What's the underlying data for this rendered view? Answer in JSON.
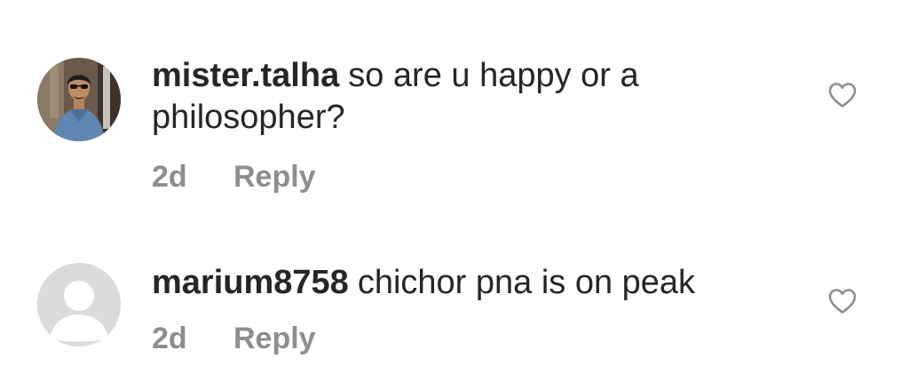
{
  "comments": [
    {
      "username": "mister.talha",
      "text": "so are u happy or a philosopher?",
      "time": "2d",
      "reply_label": "Reply",
      "avatar": "user-photo",
      "like_icon": "heart-outline-icon"
    },
    {
      "username": "marium8758",
      "text": "chichor pna is on peak",
      "time": "2d",
      "reply_label": "Reply",
      "avatar": "default-avatar",
      "like_icon": "heart-outline-icon"
    }
  ],
  "colors": {
    "text": "#262626",
    "secondary": "#8e8e8e",
    "default_avatar_bg": "#dbdbdb",
    "default_avatar_fg": "#ffffff"
  }
}
